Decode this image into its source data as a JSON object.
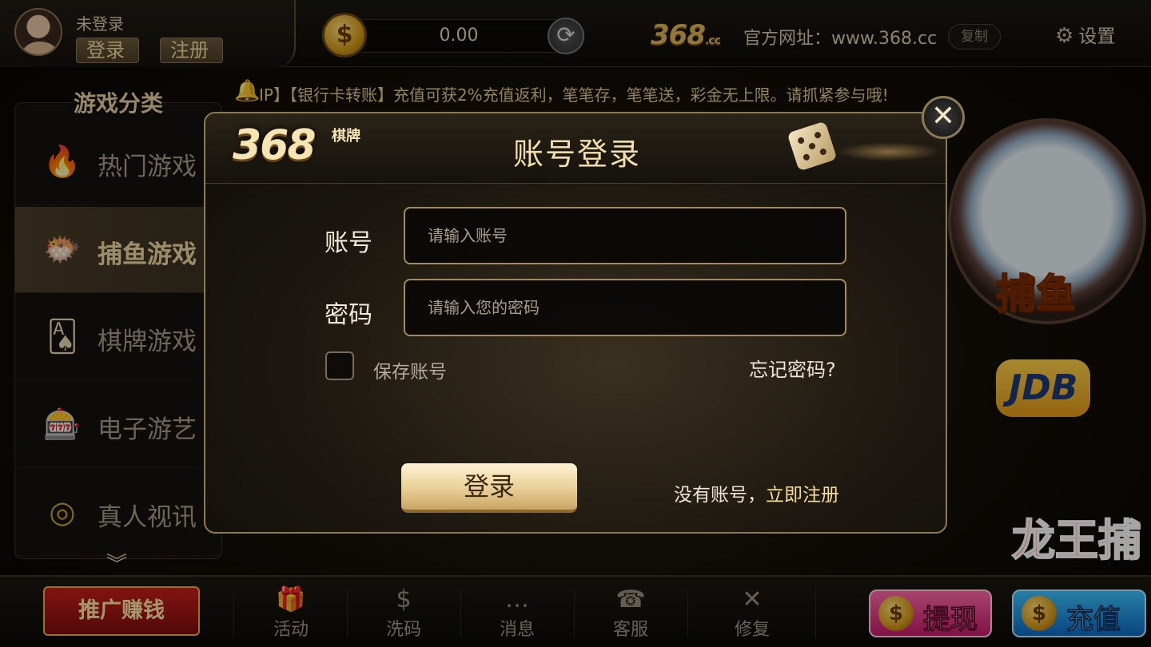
{
  "user": {
    "name": "未登录",
    "login_label": "登录",
    "register_label": "注册"
  },
  "wallet": {
    "balance": "0.00",
    "coin_symbol": "$",
    "refresh_symbol": "⟳"
  },
  "site": {
    "logo": "368",
    "logo_suffix": ".cc",
    "url_text": "官方网址：www.368.cc",
    "copy_label": "复制"
  },
  "settings": {
    "label": "设置",
    "icon": "gear-icon"
  },
  "notice": {
    "text": "IP】【银行卡转账】充值可获2%充值返利，笔笔存，笔笔送，彩金无上限。请抓紧参与哦!"
  },
  "sidebar": {
    "title": "游戏分类",
    "items": [
      {
        "label": "热门游戏",
        "icon": "hot-fire-icon",
        "active": false
      },
      {
        "label": "捕鱼游戏",
        "icon": "fish-icon",
        "active": true
      },
      {
        "label": "棋牌游戏",
        "icon": "playing-cards-icon",
        "active": false
      },
      {
        "label": "电子游艺",
        "icon": "slot-machine-icon",
        "active": false
      },
      {
        "label": "真人视讯",
        "icon": "roulette-icon",
        "active": false
      }
    ],
    "more_symbol": "︾"
  },
  "games": {
    "fish_label": "捕鱼",
    "jdb_label": "JDB",
    "dragon_label": "龙王捕"
  },
  "bottom_nav": {
    "promo_label": "推广赚钱",
    "items": [
      {
        "label": "活动",
        "icon": "gift-icon",
        "glyph": "🎁"
      },
      {
        "label": "洗码",
        "icon": "dollar-coin-icon",
        "glyph": "$"
      },
      {
        "label": "消息",
        "icon": "message-icon",
        "glyph": "…"
      },
      {
        "label": "客服",
        "icon": "customer-service-icon",
        "glyph": "☎"
      },
      {
        "label": "修复",
        "icon": "repair-tools-icon",
        "glyph": "✕"
      }
    ],
    "withdraw_label": "提现",
    "deposit_label": "充值"
  },
  "login_modal": {
    "title": "账号登录",
    "logo": "368",
    "logo_sub": "棋牌",
    "close_symbol": "✕",
    "account_label": "账号",
    "account_placeholder": "请输入账号",
    "password_label": "密码",
    "password_placeholder": "请输入您的密码",
    "save_account_label": "保存账号",
    "save_account_checked": false,
    "forgot_label": "忘记密码?",
    "login_button": "登录",
    "register_prefix": "没有账号，",
    "register_link": "立即注册"
  },
  "colors": {
    "gold": "#e0b45a",
    "panel_border": "#8e7a52",
    "accent_pink": "#c81a6a",
    "accent_blue": "#0f6ac4",
    "promo_red": "#c8201c"
  }
}
